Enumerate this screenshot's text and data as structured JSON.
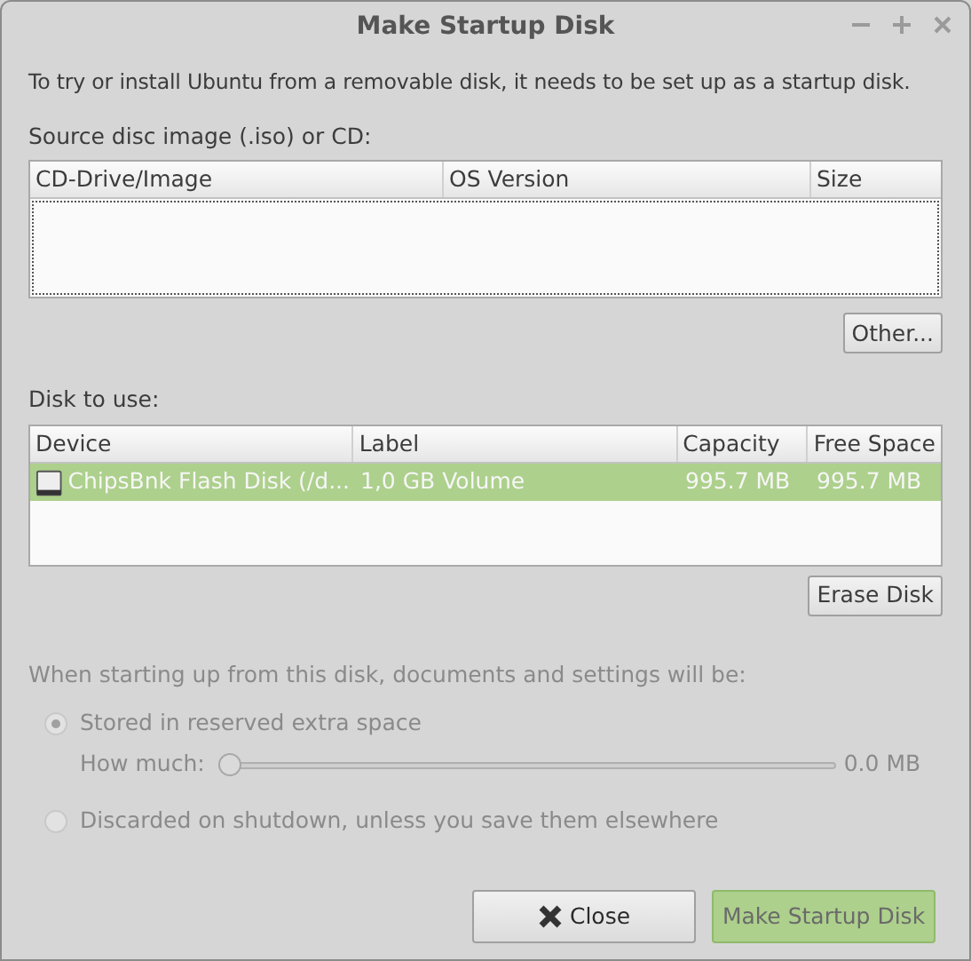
{
  "window": {
    "title": "Make Startup Disk"
  },
  "intro": "To try or install Ubuntu from a removable disk, it needs to be set up as a startup disk.",
  "source": {
    "label": "Source disc image (.iso) or CD:",
    "columns": [
      "CD-Drive/Image",
      "OS Version",
      "Size"
    ],
    "other_button": "Other..."
  },
  "disks": {
    "label": "Disk to use:",
    "columns": [
      "Device",
      "Label",
      "Capacity",
      "Free Space"
    ],
    "rows": [
      {
        "cells": [
          "ChipsBnk Flash Disk (/d...",
          "1,0 GB Volume",
          "995.7 MB",
          "995.7 MB"
        ],
        "selected": true
      }
    ],
    "erase_button": "Erase Disk"
  },
  "persistence": {
    "disabled": true,
    "heading": "When starting up from this disk, documents and settings will be:",
    "options": [
      {
        "label": "Stored in reserved extra space",
        "selected": true
      },
      {
        "label": "Discarded on shutdown, unless you save them elsewhere",
        "selected": false
      }
    ],
    "how_much": {
      "label": "How much:",
      "level": 0,
      "reading": "0.0 MB"
    }
  },
  "buttons": [
    {
      "kind": "close",
      "label": "Close",
      "disabled": false
    },
    {
      "kind": "primary",
      "label": "Make Startup Disk",
      "disabled": true
    }
  ]
}
